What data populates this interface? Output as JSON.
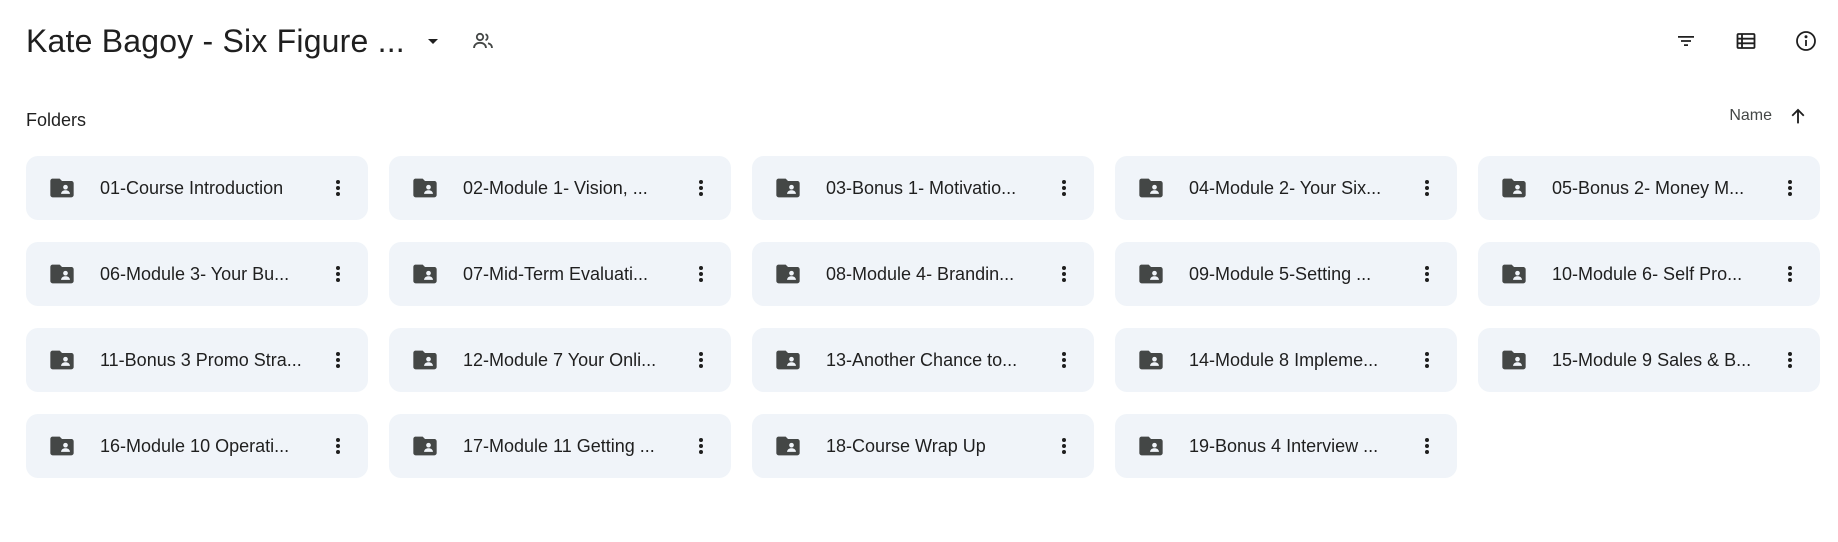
{
  "header": {
    "title": "Kate Bagoy - Six Figure ...",
    "title_dropdown_icon": "caret-down-icon",
    "shared_icon": "shared-people-icon",
    "toolbar": [
      {
        "name": "filter-button",
        "icon": "filter-icon"
      },
      {
        "name": "list-view-button",
        "icon": "list-view-icon"
      },
      {
        "name": "details-button",
        "icon": "info-icon"
      }
    ]
  },
  "section": {
    "label": "Folders",
    "sort_label": "Name",
    "sort_direction_icon": "arrow-up-icon"
  },
  "folders": [
    {
      "name": "01-Course Introduction"
    },
    {
      "name": "02-Module 1- Vision, ..."
    },
    {
      "name": "03-Bonus 1- Motivatio..."
    },
    {
      "name": "04-Module 2- Your Six..."
    },
    {
      "name": "05-Bonus 2- Money M..."
    },
    {
      "name": "06-Module 3- Your Bu..."
    },
    {
      "name": "07-Mid-Term Evaluati..."
    },
    {
      "name": "08-Module 4- Brandin..."
    },
    {
      "name": "09-Module 5-Setting ..."
    },
    {
      "name": "10-Module 6- Self Pro..."
    },
    {
      "name": "11-Bonus 3 Promo Stra..."
    },
    {
      "name": "12-Module 7 Your Onli..."
    },
    {
      "name": "13-Another Chance to..."
    },
    {
      "name": "14-Module 8 Impleme..."
    },
    {
      "name": "15-Module 9 Sales & B..."
    },
    {
      "name": "16-Module 10 Operati..."
    },
    {
      "name": "17-Module 11 Getting ..."
    },
    {
      "name": "18-Course Wrap Up"
    },
    {
      "name": "19-Bonus 4 Interview ..."
    }
  ],
  "colors": {
    "card_bg": "#f0f4f9",
    "icon": "#444746",
    "text": "#1f1f1f"
  }
}
